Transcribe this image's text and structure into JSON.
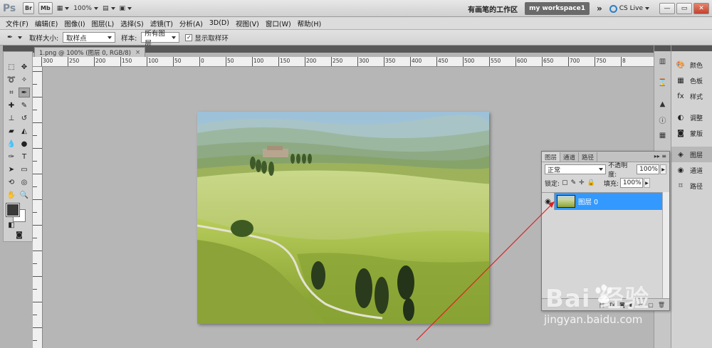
{
  "app": {
    "logo": "Ps",
    "bar_buttons": [
      "Br",
      "Mb"
    ],
    "zoom": "100%",
    "workspace_label": "有画笔的工作区",
    "workspace_button": "my workspace1",
    "more": "»",
    "cs_live": "CS Live",
    "window_controls": [
      "—",
      "▭",
      "✕"
    ]
  },
  "menu": [
    "文件(F)",
    "编辑(E)",
    "图像(I)",
    "图层(L)",
    "选择(S)",
    "滤镜(T)",
    "分析(A)",
    "3D(D)",
    "视图(V)",
    "窗口(W)",
    "帮助(H)"
  ],
  "options": {
    "sample_size_label": "取样大小:",
    "sample_size_value": "取样点",
    "sample_label": "样本:",
    "sample_value": "所有图层",
    "show_ring_label": "显示取样环",
    "show_ring_checked": "✓"
  },
  "document": {
    "tab_title": "1.png @ 100% (图层 0, RGB/8)",
    "tab_close": "×",
    "ruler_labels": [
      "300",
      "250",
      "200",
      "150",
      "100",
      "50",
      "0",
      "50",
      "100",
      "150",
      "200",
      "250",
      "300",
      "350",
      "400",
      "450",
      "500",
      "550",
      "600",
      "650",
      "700",
      "750",
      "8"
    ]
  },
  "dock": {
    "items_group1": [
      {
        "label": "颜色",
        "icon": "color-icon"
      },
      {
        "label": "色板",
        "icon": "swatches-icon"
      },
      {
        "label": "样式",
        "icon": "styles-icon"
      }
    ],
    "items_group2": [
      {
        "label": "调整",
        "icon": "adjustments-icon"
      },
      {
        "label": "蒙版",
        "icon": "masks-icon"
      }
    ],
    "items_group3": [
      {
        "label": "图层",
        "icon": "layers-icon"
      },
      {
        "label": "通道",
        "icon": "channels-icon"
      },
      {
        "label": "路径",
        "icon": "paths-icon"
      }
    ]
  },
  "layers_panel": {
    "tabs": [
      "图层",
      "通道",
      "路径"
    ],
    "menu": "▸▸ ≡",
    "blend_mode": "正常",
    "opacity_label": "不透明度:",
    "opacity_value": "100%",
    "lock_label": "锁定:",
    "fill_label": "填充:",
    "fill_value": "100%",
    "layer_name": "图层 0",
    "eye": "👁"
  },
  "watermark": {
    "brand": "Bai  经验",
    "url": "jingyan.baidu.com"
  },
  "colors": {
    "accent": "#3399ff",
    "workspace_button": "#6a6a6a",
    "arrow": "#e02020"
  }
}
